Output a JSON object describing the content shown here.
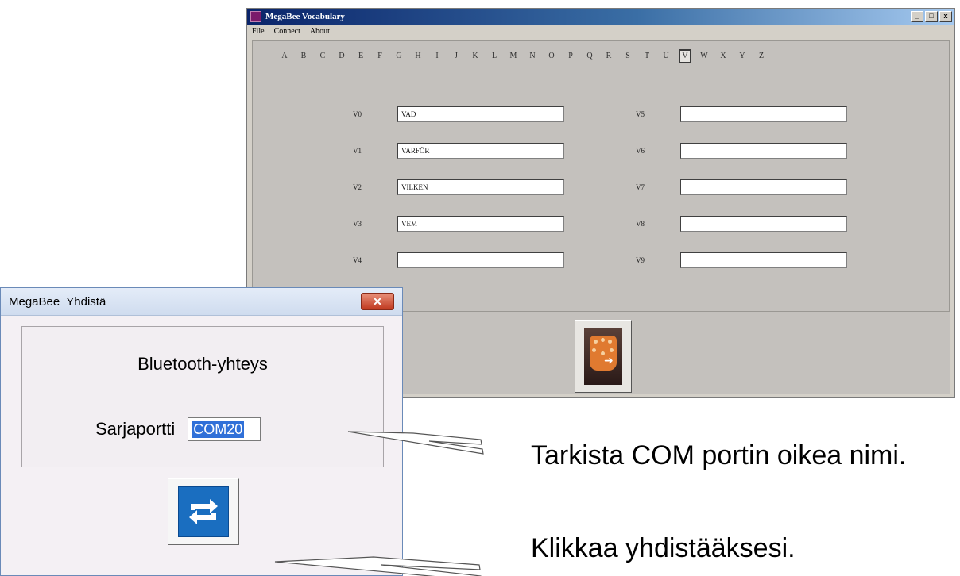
{
  "main_window": {
    "title": "MegaBee Vocabulary",
    "menu": [
      "File",
      "Connect",
      "About"
    ],
    "window_buttons": [
      "_",
      "□",
      "x"
    ],
    "letters": [
      "A",
      "B",
      "C",
      "D",
      "E",
      "F",
      "G",
      "H",
      "I",
      "J",
      "K",
      "L",
      "M",
      "N",
      "O",
      "P",
      "Q",
      "R",
      "S",
      "T",
      "U",
      "V",
      "W",
      "X",
      "Y",
      "Z"
    ],
    "selected_letter": "V",
    "left_fields": [
      {
        "id": "V0",
        "value": "VAD"
      },
      {
        "id": "V1",
        "value": "VARFÖR"
      },
      {
        "id": "V2",
        "value": "VILKEN"
      },
      {
        "id": "V3",
        "value": "VEM"
      },
      {
        "id": "V4",
        "value": ""
      }
    ],
    "right_fields": [
      {
        "id": "V5",
        "value": ""
      },
      {
        "id": "V6",
        "value": ""
      },
      {
        "id": "V7",
        "value": ""
      },
      {
        "id": "V8",
        "value": ""
      },
      {
        "id": "V9",
        "value": ""
      }
    ],
    "device_icon": "megabee-device-icon"
  },
  "dialog": {
    "title": "MegaBee  Yhdistä",
    "close_label": "✕",
    "heading": "Bluetooth-yhteys",
    "port_label": "Sarjaportti",
    "port_value": "COM20",
    "connect_icon": "refresh-arrows-icon"
  },
  "annotations": {
    "com_hint": "Tarkista COM portin oikea nimi.",
    "connect_hint": "Klikkaa yhdistääksesi."
  }
}
